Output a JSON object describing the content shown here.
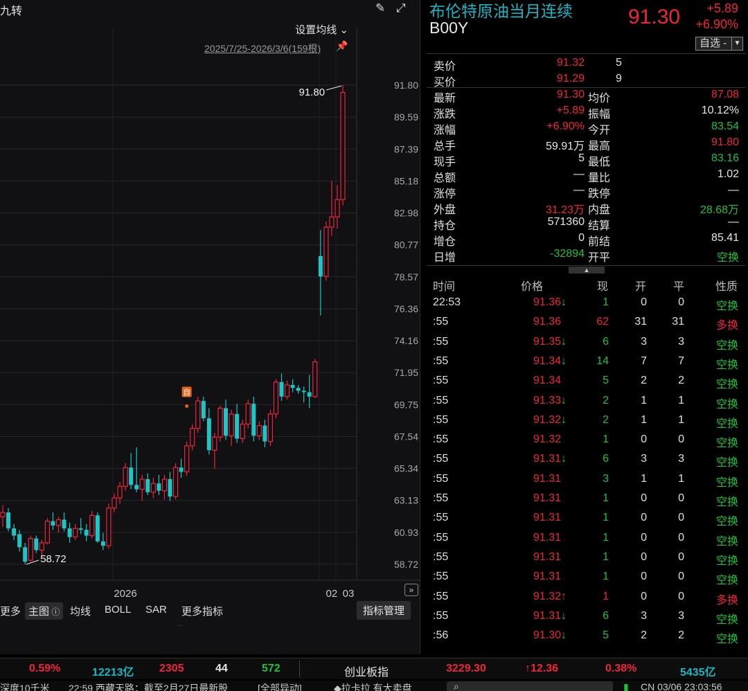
{
  "chart_header": {
    "title_fragment": "九转",
    "ma_setting": "设置均线",
    "range_label": "2025/7/25-2026/3/6(159根)",
    "toolbar": {
      "more": "更多",
      "main_chart": "主图",
      "ma": "均线",
      "boll": "BOLL",
      "sar": "SAR",
      "more_indicators": "更多指标",
      "indicator_mgmt": "指标管理"
    }
  },
  "chart_data": {
    "type": "candlestick",
    "y_ticks": [
      "91.80",
      "89.59",
      "87.39",
      "85.18",
      "82.98",
      "80.77",
      "78.57",
      "76.36",
      "74.16",
      "71.95",
      "69.75",
      "67.54",
      "65.34",
      "63.13",
      "60.93",
      "58.72"
    ],
    "ylim": [
      58.72,
      91.8
    ],
    "x_labels": [
      "2026",
      "02",
      "03"
    ],
    "annotations": {
      "high_label": "91.80",
      "low_label": "58.72",
      "marker": "自"
    },
    "candles": [
      [
        62.0,
        62.8,
        61.3,
        62.3
      ],
      [
        62.3,
        62.6,
        61.0,
        61.2
      ],
      [
        61.2,
        61.5,
        60.4,
        60.7
      ],
      [
        60.8,
        61.1,
        59.6,
        59.9
      ],
      [
        59.9,
        60.2,
        58.72,
        58.9
      ],
      [
        59.0,
        60.7,
        58.9,
        60.5
      ],
      [
        60.5,
        60.7,
        59.5,
        59.7
      ],
      [
        59.7,
        60.4,
        59.3,
        60.2
      ],
      [
        60.2,
        61.9,
        60.1,
        61.7
      ],
      [
        61.7,
        62.3,
        61.1,
        61.4
      ],
      [
        61.4,
        62.0,
        60.9,
        61.8
      ],
      [
        61.8,
        62.3,
        61.0,
        61.2
      ],
      [
        61.2,
        61.6,
        60.2,
        60.6
      ],
      [
        60.6,
        61.5,
        60.4,
        61.2
      ],
      [
        61.2,
        61.9,
        60.8,
        61.1
      ],
      [
        61.1,
        61.5,
        60.3,
        60.7
      ],
      [
        60.7,
        62.4,
        60.5,
        62.1
      ],
      [
        62.1,
        62.3,
        60.2,
        60.3
      ],
      [
        60.3,
        60.9,
        59.7,
        60.0
      ],
      [
        60.0,
        62.9,
        59.8,
        62.6
      ],
      [
        62.6,
        63.6,
        62.3,
        63.3
      ],
      [
        63.3,
        64.4,
        62.9,
        64.1
      ],
      [
        64.1,
        65.7,
        63.8,
        65.4
      ],
      [
        65.4,
        66.4,
        63.9,
        64.2
      ],
      [
        64.2,
        66.8,
        63.7,
        63.9
      ],
      [
        63.9,
        64.9,
        63.1,
        64.6
      ],
      [
        64.6,
        65.0,
        63.5,
        63.7
      ],
      [
        63.7,
        64.7,
        63.3,
        64.3
      ],
      [
        64.3,
        64.9,
        63.5,
        63.8
      ],
      [
        63.8,
        64.9,
        63.2,
        64.6
      ],
      [
        64.6,
        65.1,
        63.1,
        63.4
      ],
      [
        63.4,
        65.7,
        63.2,
        65.4
      ],
      [
        65.4,
        66.0,
        64.7,
        65.1
      ],
      [
        65.1,
        67.2,
        64.8,
        66.9
      ],
      [
        66.9,
        68.4,
        66.6,
        68.1
      ],
      [
        68.1,
        70.3,
        67.8,
        70.0
      ],
      [
        70.0,
        70.3,
        68.6,
        68.8
      ],
      [
        68.8,
        69.5,
        66.3,
        66.6
      ],
      [
        66.6,
        67.8,
        65.3,
        67.5
      ],
      [
        67.5,
        69.7,
        67.2,
        69.5
      ],
      [
        69.5,
        70.1,
        67.3,
        67.6
      ],
      [
        67.6,
        69.4,
        66.9,
        69.1
      ],
      [
        69.1,
        69.8,
        67.1,
        67.4
      ],
      [
        67.4,
        68.7,
        67.1,
        68.4
      ],
      [
        68.4,
        70.1,
        68.1,
        69.8
      ],
      [
        69.8,
        70.3,
        67.2,
        67.6
      ],
      [
        67.6,
        68.6,
        67.3,
        68.3
      ],
      [
        68.3,
        68.7,
        66.8,
        67.2
      ],
      [
        67.2,
        69.4,
        66.9,
        69.1
      ],
      [
        69.1,
        71.5,
        68.8,
        71.3
      ],
      [
        71.3,
        71.9,
        70.0,
        70.3
      ],
      [
        70.3,
        71.4,
        70.1,
        71.1
      ],
      [
        71.1,
        71.5,
        70.6,
        70.9
      ],
      [
        70.9,
        71.1,
        70.5,
        70.7
      ],
      [
        70.7,
        71.0,
        69.9,
        70.6
      ],
      [
        70.6,
        71.8,
        69.5,
        70.3
      ],
      [
        70.3,
        72.9,
        70.2,
        72.7
      ],
      [
        80.0,
        81.8,
        75.9,
        78.6
      ],
      [
        78.6,
        82.4,
        78.3,
        82.0
      ],
      [
        82.0,
        85.2,
        81.4,
        82.7
      ],
      [
        82.7,
        84.9,
        81.9,
        83.9
      ],
      [
        83.9,
        91.8,
        83.5,
        91.3
      ]
    ]
  },
  "quote": {
    "name": "布伦特原油当月连续",
    "code": "B00Y",
    "price": "91.30",
    "change": "+5.89",
    "change_pct": "+6.90%",
    "watch_btn": "自选 -",
    "orderbook": [
      {
        "label": "卖价",
        "value": "91.32",
        "qty": "5"
      },
      {
        "label": "买价",
        "value": "91.29",
        "qty": "9"
      }
    ],
    "rows": [
      {
        "l1": "最新",
        "v1": "91.30",
        "c1": "red",
        "l2": "均价",
        "v2": "87.08",
        "c2": "red"
      },
      {
        "l1": "涨跌",
        "v1": "+5.89",
        "c1": "red",
        "l2": "振幅",
        "v2": "10.12%",
        "c2": "white"
      },
      {
        "l1": "涨幅",
        "v1": "+6.90%",
        "c1": "red",
        "l2": "今开",
        "v2": "83.54",
        "c2": "green"
      },
      {
        "l1": "总手",
        "v1": "59.91万",
        "c1": "white",
        "l2": "最高",
        "v2": "91.80",
        "c2": "red"
      },
      {
        "l1": "现手",
        "v1": "5",
        "c1": "white",
        "l2": "最低",
        "v2": "83.16",
        "c2": "green"
      },
      {
        "l1": "总额",
        "v1": "—",
        "c1": "white",
        "l2": "量比",
        "v2": "1.02",
        "c2": "white"
      },
      {
        "l1": "涨停",
        "v1": "—",
        "c1": "white",
        "l2": "跌停",
        "v2": "—",
        "c2": "white"
      },
      {
        "l1": "外盘",
        "v1": "31.23万",
        "c1": "red",
        "l2": "内盘",
        "v2": "28.68万",
        "c2": "green"
      },
      {
        "l1": "持仓",
        "v1": "571360",
        "c1": "white",
        "l2": "结算",
        "v2": "—",
        "c2": "white"
      },
      {
        "l1": "增仓",
        "v1": "0",
        "c1": "white",
        "l2": "前结",
        "v2": "85.41",
        "c2": "white"
      },
      {
        "l1": "日增",
        "v1": "-32894",
        "c1": "green",
        "l2": "开平",
        "v2": "空换",
        "c2": "green"
      }
    ]
  },
  "ticks": {
    "headers": {
      "time": "时间",
      "price": "价格",
      "vol": "现",
      "open": "开",
      "close": "平",
      "nature": "性质"
    },
    "rows": [
      {
        "time": "22:53",
        "price": "91.36",
        "dir": "down",
        "vol": "1",
        "open": "0",
        "close": "0",
        "nature": "空换",
        "side": "sell"
      },
      {
        "time": ":55",
        "price": "91.36",
        "dir": "",
        "vol": "62",
        "open": "31",
        "close": "31",
        "nature": "多换",
        "side": "buy"
      },
      {
        "time": ":55",
        "price": "91.35",
        "dir": "down",
        "vol": "6",
        "open": "3",
        "close": "3",
        "nature": "空换",
        "side": "sell"
      },
      {
        "time": ":55",
        "price": "91.34",
        "dir": "down",
        "vol": "14",
        "open": "7",
        "close": "7",
        "nature": "空换",
        "side": "sell"
      },
      {
        "time": ":55",
        "price": "91.34",
        "dir": "",
        "vol": "5",
        "open": "2",
        "close": "2",
        "nature": "空换",
        "side": "sell"
      },
      {
        "time": ":55",
        "price": "91.33",
        "dir": "down",
        "vol": "2",
        "open": "1",
        "close": "1",
        "nature": "空换",
        "side": "sell"
      },
      {
        "time": ":55",
        "price": "91.32",
        "dir": "down",
        "vol": "2",
        "open": "1",
        "close": "1",
        "nature": "空换",
        "side": "sell"
      },
      {
        "time": ":55",
        "price": "91.32",
        "dir": "",
        "vol": "1",
        "open": "0",
        "close": "0",
        "nature": "空换",
        "side": "sell"
      },
      {
        "time": ":55",
        "price": "91.31",
        "dir": "down",
        "vol": "6",
        "open": "3",
        "close": "3",
        "nature": "空换",
        "side": "sell"
      },
      {
        "time": ":55",
        "price": "91.31",
        "dir": "",
        "vol": "3",
        "open": "1",
        "close": "1",
        "nature": "空换",
        "side": "sell"
      },
      {
        "time": ":55",
        "price": "91.31",
        "dir": "",
        "vol": "1",
        "open": "0",
        "close": "0",
        "nature": "空换",
        "side": "sell"
      },
      {
        "time": ":55",
        "price": "91.31",
        "dir": "",
        "vol": "1",
        "open": "0",
        "close": "0",
        "nature": "空换",
        "side": "sell"
      },
      {
        "time": ":55",
        "price": "91.31",
        "dir": "",
        "vol": "1",
        "open": "0",
        "close": "0",
        "nature": "空换",
        "side": "sell"
      },
      {
        "time": ":55",
        "price": "91.31",
        "dir": "",
        "vol": "1",
        "open": "0",
        "close": "0",
        "nature": "空换",
        "side": "sell"
      },
      {
        "time": ":55",
        "price": "91.31",
        "dir": "",
        "vol": "1",
        "open": "0",
        "close": "0",
        "nature": "空换",
        "side": "sell"
      },
      {
        "time": ":55",
        "price": "91.32",
        "dir": "up",
        "vol": "1",
        "open": "0",
        "close": "0",
        "nature": "多换",
        "side": "buy"
      },
      {
        "time": ":55",
        "price": "91.31",
        "dir": "down",
        "vol": "6",
        "open": "3",
        "close": "3",
        "nature": "空换",
        "side": "sell"
      },
      {
        "time": ":56",
        "price": "91.30",
        "dir": "down",
        "vol": "5",
        "open": "2",
        "close": "2",
        "nature": "空换",
        "side": "sell"
      }
    ]
  },
  "index_bar": {
    "pct": "0.59%",
    "amount": "12213亿",
    "up": "2305",
    "flat": "44",
    "down": "572",
    "name": "创业板指",
    "value": "3229.30",
    "chg": "↑12.36",
    "chg_pct": "0.38%",
    "amount2": "5435亿"
  },
  "news_bar": {
    "item1": "深度10千米",
    "item2": "22:59 西藏天路：截至2月27日最新股",
    "item3": "[全部异动]",
    "item4": "◆拉卡拉 有大卖盘",
    "clock": "CN 03/06 23:03:56"
  },
  "colors": {
    "up": "#f0243c",
    "down": "#1ec23a",
    "candle_down": "#21c4c4",
    "accent": "#18b6c4"
  }
}
